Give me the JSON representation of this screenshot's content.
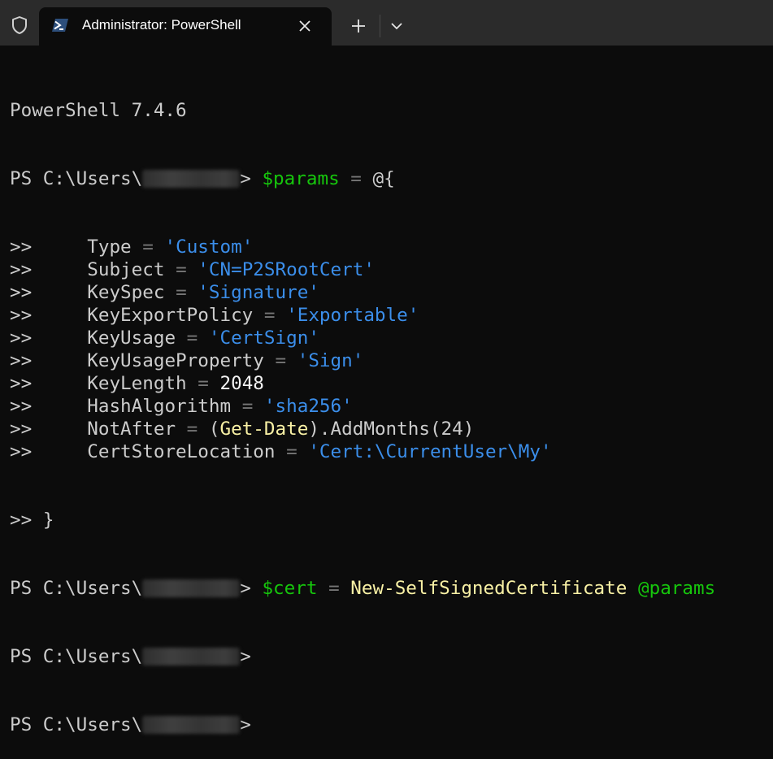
{
  "window": {
    "tab_title": "Administrator: PowerShell",
    "new_tab_symbol": "+",
    "icons": {
      "shield": "shield-icon",
      "powershell": "powershell-icon",
      "close": "close-icon",
      "new_tab": "plus-icon",
      "dropdown": "chevron-down-icon"
    }
  },
  "terminal": {
    "banner": "PowerShell 7.4.6",
    "prompt_prefix": "PS C:\\Users\\",
    "prompt_suffix": ">",
    "cont": ">>",
    "params_cmd": {
      "var": "$params",
      "op": "=",
      "rest": "@{"
    },
    "params": [
      {
        "key": "Type",
        "op": "=",
        "value": "'Custom'",
        "kind": "str"
      },
      {
        "key": "Subject",
        "op": "=",
        "value": "'CN=P2SRootCert'",
        "kind": "str"
      },
      {
        "key": "KeySpec",
        "op": "=",
        "value": "'Signature'",
        "kind": "str"
      },
      {
        "key": "KeyExportPolicy",
        "op": "=",
        "value": "'Exportable'",
        "kind": "str"
      },
      {
        "key": "KeyUsage",
        "op": "=",
        "value": "'CertSign'",
        "kind": "str"
      },
      {
        "key": "KeyUsageProperty",
        "op": "=",
        "value": "'Sign'",
        "kind": "str"
      },
      {
        "key": "KeyLength",
        "op": "=",
        "value": "2048",
        "kind": "num"
      },
      {
        "key": "HashAlgorithm",
        "op": "=",
        "value": "'sha256'",
        "kind": "str"
      },
      {
        "key": "NotAfter",
        "op": "=",
        "kind": "expr",
        "paren_open": "(",
        "cmd": "Get-Date",
        "tail": ").AddMonths(24)"
      },
      {
        "key": "CertStoreLocation",
        "op": "=",
        "value": "'Cert:\\CurrentUser\\My'",
        "kind": "str"
      }
    ],
    "close_brace": "}",
    "cert_cmd": {
      "var": "$cert",
      "op": "=",
      "cmd": "New-SelfSignedCertificate",
      "arg": "@params"
    },
    "colors": {
      "background": "#0c0c0c",
      "foreground": "#cccccc",
      "variable": "#16c60c",
      "string": "#3b8eea",
      "command": "#f9f1a5"
    }
  }
}
